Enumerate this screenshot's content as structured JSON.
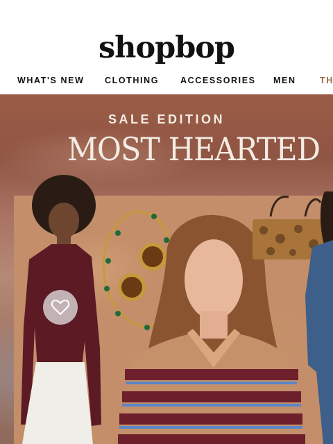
{
  "brand": {
    "logo": "shopbop"
  },
  "nav": {
    "items": [
      "WHAT'S NEW",
      "CLOTHING",
      "ACCESSORIES",
      "MEN",
      "TH"
    ]
  },
  "hero": {
    "eyebrow": "SALE EDITION",
    "headline": "MOST HEARTED"
  }
}
